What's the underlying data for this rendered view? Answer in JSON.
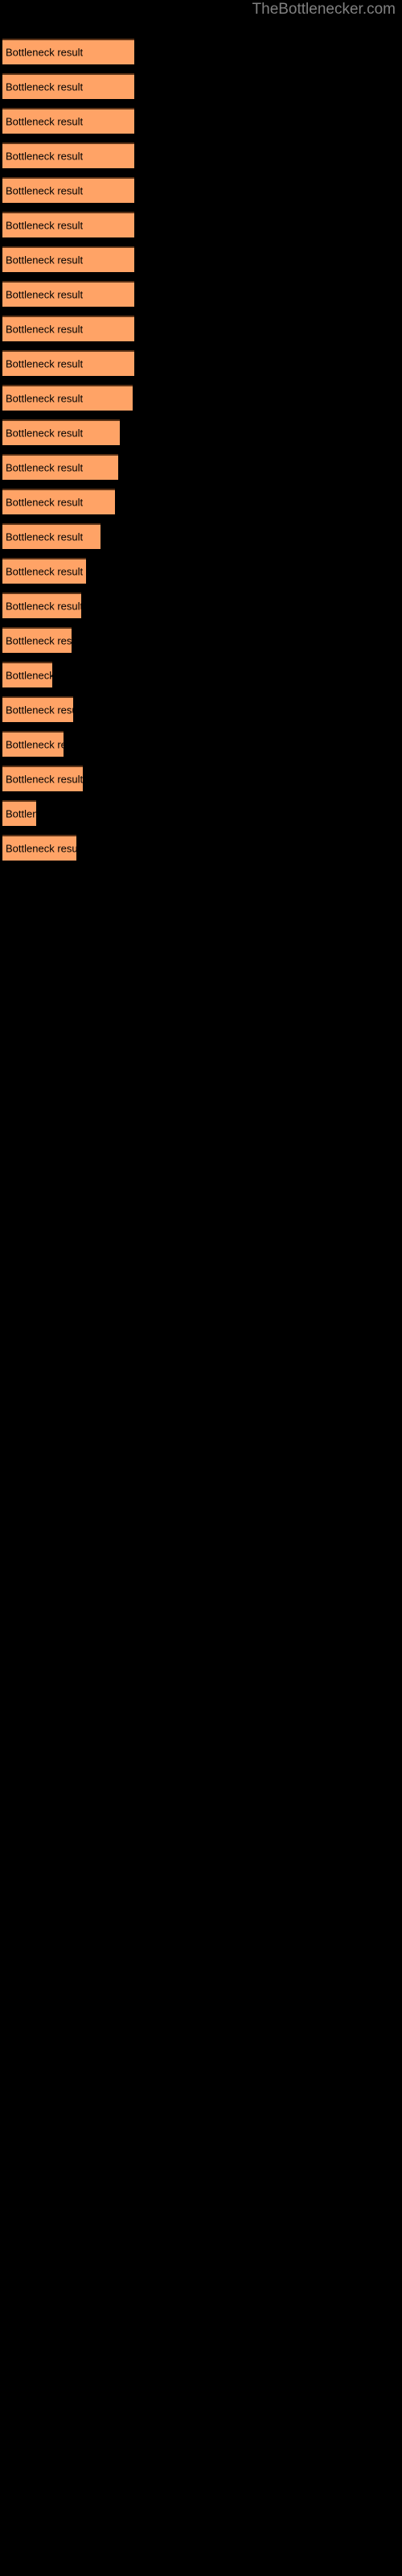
{
  "site": {
    "title": "TheBottlenecker.com",
    "title_color": "#808080"
  },
  "colors": {
    "background": "#000000",
    "bar_fill": "#FFA366",
    "bar_border_top": "#5C3317",
    "bar_label": "#000000"
  },
  "chart_data": {
    "type": "bar",
    "orientation": "horizontal",
    "title": "",
    "subtitle": "",
    "xlabel": "",
    "ylabel": "",
    "grid": false,
    "legend": false,
    "axis_visible": false,
    "bar_label_text": "Bottleneck result",
    "xlim": [
      0,
      82
    ],
    "categories": [
      "bar-1",
      "bar-2",
      "bar-3",
      "bar-4",
      "bar-5",
      "bar-6",
      "bar-7",
      "bar-8",
      "bar-9",
      "bar-10",
      "bar-11",
      "bar-12",
      "bar-13",
      "bar-14",
      "bar-15",
      "bar-16",
      "bar-17",
      "bar-18",
      "bar-19",
      "bar-20",
      "bar-21",
      "bar-22",
      "bar-23",
      "bar-24"
    ],
    "values": [
      82,
      82,
      82,
      82,
      82,
      82,
      82,
      82,
      82,
      82,
      81,
      73,
      72,
      70,
      61,
      52,
      49,
      43,
      31,
      44,
      38,
      50,
      21,
      46
    ],
    "bars": [
      {
        "name": "bar-1",
        "top": 48,
        "width": 82,
        "label": "Bottleneck result"
      },
      {
        "name": "bar-2",
        "top": 91,
        "width": 82,
        "label": "Bottleneck result"
      },
      {
        "name": "bar-3",
        "top": 134,
        "width": 82,
        "label": "Bottleneck result"
      },
      {
        "name": "bar-4",
        "top": 177,
        "width": 82,
        "label": "Bottleneck result"
      },
      {
        "name": "bar-5",
        "top": 220,
        "width": 82,
        "label": "Bottleneck result"
      },
      {
        "name": "bar-6",
        "top": 263,
        "width": 82,
        "label": "Bottleneck result"
      },
      {
        "name": "bar-7",
        "top": 306,
        "width": 82,
        "label": "Bottleneck result"
      },
      {
        "name": "bar-8",
        "top": 349,
        "width": 82,
        "label": "Bottleneck result"
      },
      {
        "name": "bar-9",
        "top": 392,
        "width": 82,
        "label": "Bottleneck result"
      },
      {
        "name": "bar-10",
        "top": 435,
        "width": 82,
        "label": "Bottleneck result"
      },
      {
        "name": "bar-11",
        "top": 478,
        "width": 81,
        "label": "Bottleneck result"
      },
      {
        "name": "bar-12",
        "top": 521,
        "width": 73,
        "label": "Bottleneck result"
      },
      {
        "name": "bar-13",
        "top": 564,
        "width": 72,
        "label": "Bottleneck result"
      },
      {
        "name": "bar-14",
        "top": 607,
        "width": 70,
        "label": "Bottleneck result"
      },
      {
        "name": "bar-15",
        "top": 650,
        "width": 61,
        "label": "Bottleneck result"
      },
      {
        "name": "bar-16",
        "top": 693,
        "width": 52,
        "label": "Bottleneck result"
      },
      {
        "name": "bar-17",
        "top": 736,
        "width": 49,
        "label": "Bottleneck result"
      },
      {
        "name": "bar-18",
        "top": 779,
        "width": 43,
        "label": "Bottleneck result"
      },
      {
        "name": "bar-19",
        "top": 822,
        "width": 31,
        "label": "Bottleneck result"
      },
      {
        "name": "bar-20",
        "top": 865,
        "width": 44,
        "label": "Bottleneck result"
      },
      {
        "name": "bar-21",
        "top": 908,
        "width": 38,
        "label": "Bottleneck result"
      },
      {
        "name": "bar-22",
        "top": 951,
        "width": 50,
        "label": "Bottleneck result"
      },
      {
        "name": "bar-23",
        "top": 994,
        "width": 21,
        "label": "Bottleneck result"
      },
      {
        "name": "bar-24",
        "top": 1037,
        "width": 46,
        "label": "Bottleneck result"
      }
    ]
  }
}
